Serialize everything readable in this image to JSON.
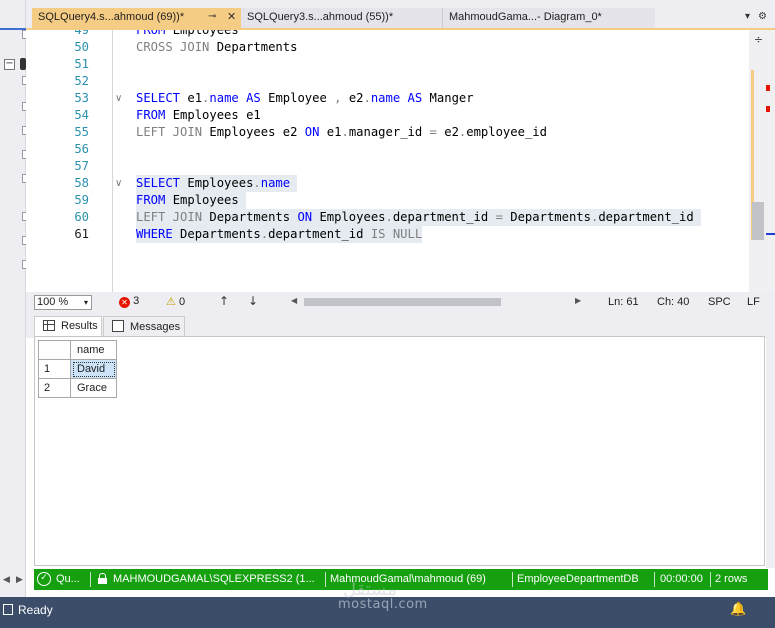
{
  "tabs": [
    {
      "label": "SQLQuery4.s...ahmoud (69))*",
      "active": true,
      "pin": "⊸",
      "close": "✕"
    },
    {
      "label": "SQLQuery3.s...ahmoud (55))*"
    },
    {
      "label": "MahmoudGama...- Diagram_0*"
    }
  ],
  "tab_menu": {
    "dropdown": "▾",
    "gear": "⚙"
  },
  "editor": {
    "lines": [
      {
        "n": "49",
        "parts": [
          {
            "t": "FROM",
            "c": "kw"
          },
          {
            "t": " Employees",
            "c": "idt"
          }
        ]
      },
      {
        "n": "50",
        "parts": [
          {
            "t": "CROSS JOIN",
            "c": "gr"
          },
          {
            "t": " Departments",
            "c": "idt"
          }
        ]
      },
      {
        "n": "51",
        "parts": []
      },
      {
        "n": "52",
        "parts": []
      },
      {
        "n": "53",
        "fold": "∨",
        "parts": [
          {
            "t": "SELECT",
            "c": "kw"
          },
          {
            "t": " e1",
            "c": "idt"
          },
          {
            "t": ".",
            "c": "gr"
          },
          {
            "t": "name",
            "c": "kw"
          },
          {
            "t": " AS",
            "c": "kw"
          },
          {
            "t": " Employee ",
            "c": "idt"
          },
          {
            "t": ",",
            "c": "gr"
          },
          {
            "t": " e2",
            "c": "idt"
          },
          {
            "t": ".",
            "c": "gr"
          },
          {
            "t": "name",
            "c": "kw"
          },
          {
            "t": " AS",
            "c": "kw"
          },
          {
            "t": " Manger",
            "c": "idt"
          }
        ]
      },
      {
        "n": "54",
        "parts": [
          {
            "t": "FROM",
            "c": "kw"
          },
          {
            "t": " Employees e1",
            "c": "idt"
          }
        ]
      },
      {
        "n": "55",
        "parts": [
          {
            "t": "LEFT JOIN",
            "c": "gr"
          },
          {
            "t": " Employees e2 ",
            "c": "idt"
          },
          {
            "t": "ON",
            "c": "kw"
          },
          {
            "t": " e1",
            "c": "idt"
          },
          {
            "t": ".",
            "c": "gr"
          },
          {
            "t": "manager_id ",
            "c": "idt"
          },
          {
            "t": "=",
            "c": "gr"
          },
          {
            "t": " e2",
            "c": "idt"
          },
          {
            "t": ".",
            "c": "gr"
          },
          {
            "t": "employee_id",
            "c": "idt"
          }
        ]
      },
      {
        "n": "56",
        "parts": []
      },
      {
        "n": "57",
        "parts": []
      },
      {
        "n": "58",
        "fold": "∨",
        "sel": true,
        "parts": [
          {
            "t": "SELECT",
            "c": "kw"
          },
          {
            "t": " Employees",
            "c": "idt"
          },
          {
            "t": ".",
            "c": "gr"
          },
          {
            "t": "name ",
            "c": "kw"
          }
        ]
      },
      {
        "n": "59",
        "sel": true,
        "parts": [
          {
            "t": "FROM",
            "c": "kw"
          },
          {
            "t": " Employees ",
            "c": "idt"
          }
        ]
      },
      {
        "n": "60",
        "sel": true,
        "parts": [
          {
            "t": "LEFT JOIN",
            "c": "gr"
          },
          {
            "t": " Departments ",
            "c": "idt"
          },
          {
            "t": "ON",
            "c": "kw"
          },
          {
            "t": " Employees",
            "c": "idt"
          },
          {
            "t": ".",
            "c": "gr"
          },
          {
            "t": "department_id ",
            "c": "idt"
          },
          {
            "t": "=",
            "c": "gr"
          },
          {
            "t": " Departments",
            "c": "idt"
          },
          {
            "t": ".",
            "c": "gr"
          },
          {
            "t": "department_id ",
            "c": "idt"
          }
        ]
      },
      {
        "n": "61",
        "sel": true,
        "current": true,
        "parts": [
          {
            "t": "WHERE",
            "c": "kw"
          },
          {
            "t": " Departments",
            "c": "idt"
          },
          {
            "t": ".",
            "c": "gr"
          },
          {
            "t": "department_id ",
            "c": "idt"
          },
          {
            "t": "IS NULL",
            "c": "gr"
          }
        ]
      }
    ]
  },
  "editor_status": {
    "zoom": "100 %",
    "zoom_dropdown": "▾",
    "errors": "3",
    "error_icon": "✕",
    "warnings": "0",
    "warning_icon": "⚠",
    "nav_up": "↑",
    "nav_down": "↓",
    "scroll_left": "◀",
    "scroll_right": "▶",
    "line": "Ln: 61",
    "col": "Ch: 40",
    "spc": "SPC",
    "lf": "LF"
  },
  "results_tabs": {
    "results": "Results",
    "messages": "Messages"
  },
  "results_grid": {
    "columns": [
      "name"
    ],
    "rows": [
      {
        "n": "1",
        "name": "David"
      },
      {
        "n": "2",
        "name": "Grace"
      }
    ]
  },
  "query_status": {
    "ok_icon": "✓",
    "state": "Qu...",
    "server": "MAHMOUDGAMAL\\SQLEXPRESS2 (1...",
    "user": "MahmoudGamal\\mahmoud (69)",
    "database": "EmployeeDepartmentDB",
    "elapsed": "00:00:00",
    "rows": "2 rows"
  },
  "app_status": {
    "ready": "Ready",
    "bell_icon": "🔔",
    "watermark": "mostaql.com",
    "watermark_ar": "مستقل"
  },
  "left_strip": {
    "minus": "−",
    "scroll_left": "◀",
    "scroll_right": "▶"
  },
  "vscroll": {
    "split_icon": "÷"
  },
  "colors": {
    "accent_tab": "#f5cc84",
    "status_green": "#16a010",
    "statusbar": "#3b4d68",
    "keyword": "#0000ff",
    "line_number": "#2b91af",
    "error": "#e51400"
  }
}
